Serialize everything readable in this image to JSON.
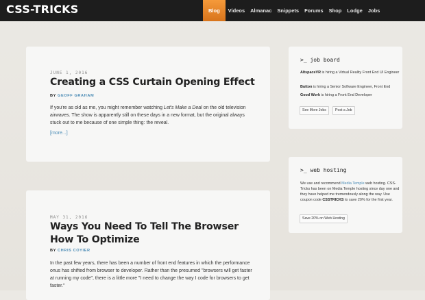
{
  "header": {
    "logo": "CSS-TRICKS",
    "nav": [
      {
        "label": "Blog",
        "active": true
      },
      {
        "label": "Videos"
      },
      {
        "label": "Almanac"
      },
      {
        "label": "Snippets"
      },
      {
        "label": "Forums"
      },
      {
        "label": "Shop"
      },
      {
        "label": "Lodge"
      },
      {
        "label": "Jobs"
      }
    ]
  },
  "posts": [
    {
      "date": "JUNE 1, 2016",
      "title": "Creating a CSS Curtain Opening Effect",
      "by": "BY",
      "author": "GEOFF GRAHAM",
      "excerpt_a": "If you're as old as me, you might remember watching ",
      "excerpt_em": "Let's Make a Deal",
      "excerpt_b": " on the old television airwaves. The show is apparently still on these days in a new format, but the original always stuck out to me because of one simple thing: the reveal.",
      "more": "[more...]"
    },
    {
      "date": "MAY 31, 2016",
      "title": "Ways You Need To Tell The Browser How To Optimize",
      "by": "BY",
      "author": "CHRIS COYIER",
      "excerpt": "In the past few years, there has been a number of front end features in which the performance onus has shifted from browser to developer. Rather than the presumed \"browsers will get faster at running my code\", there is a little more \"I need to change the way I code for browsers to get faster.\""
    }
  ],
  "job_board": {
    "title": ">_ job board",
    "jobs": [
      {
        "company": "AltspaceVR",
        "text": " is hiring a Virtual Reality Front End UI Engineer"
      },
      {
        "company": "Button",
        "text": " is hiring a Senior Software Engineer, Front End"
      },
      {
        "company": "Good Work",
        "text": " is hiring a Front End Developer"
      }
    ],
    "see_more": "See More Jobs",
    "post_job": "Post a Job"
  },
  "web_hosting": {
    "title": ">_ web hosting",
    "text_a": "We use and recommend ",
    "link": "Media Temple",
    "text_b": " web hosting. CSS-Tricks has been on Media Temple hosting since day one and they have helped me tremendously along the way. Use coupon code ",
    "code": "CSSTRICKS",
    "text_c": " to save 20% for the first year.",
    "button": "Save 20% on Web Hosting"
  }
}
